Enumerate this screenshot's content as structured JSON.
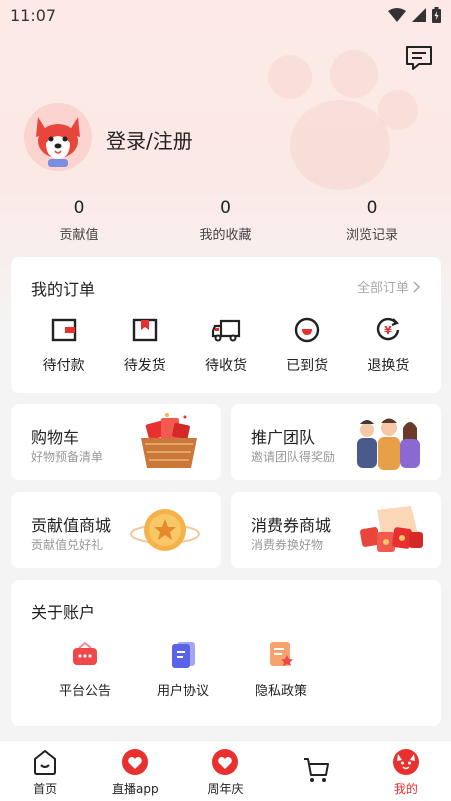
{
  "status_bar": {
    "time": "11:07"
  },
  "profile": {
    "login_text": "登录/注册"
  },
  "stats": [
    {
      "value": "0",
      "label": "贡献值"
    },
    {
      "value": "0",
      "label": "我的收藏"
    },
    {
      "value": "0",
      "label": "浏览记录"
    }
  ],
  "orders": {
    "title": "我的订单",
    "all_label": "全部订单",
    "items": [
      {
        "label": "待付款",
        "icon": "wallet-icon"
      },
      {
        "label": "待发货",
        "icon": "package-icon"
      },
      {
        "label": "待收货",
        "icon": "truck-icon"
      },
      {
        "label": "已到货",
        "icon": "smile-bag-icon"
      },
      {
        "label": "退换货",
        "icon": "refund-icon"
      }
    ]
  },
  "promos": [
    {
      "title": "购物车",
      "subtitle": "好物预备清单",
      "icon": "shopping-basket-icon"
    },
    {
      "title": "推广团队",
      "subtitle": "邀请团队得奖励",
      "icon": "team-people-icon"
    },
    {
      "title": "贡献值商城",
      "subtitle": "贡献值兑好礼",
      "icon": "star-coin-icon"
    },
    {
      "title": "消费券商城",
      "subtitle": "消费券换好物",
      "icon": "red-envelope-icon"
    }
  ],
  "account": {
    "title": "关于账户",
    "items": [
      {
        "label": "平台公告",
        "icon": "announcement-icon"
      },
      {
        "label": "用户协议",
        "icon": "agreement-icon"
      },
      {
        "label": "隐私政策",
        "icon": "privacy-policy-icon"
      }
    ]
  },
  "tabs": [
    {
      "label": "首页",
      "icon": "home-icon"
    },
    {
      "label": "直播app",
      "icon": "live-heart-icon"
    },
    {
      "label": "周年庆",
      "icon": "anniversary-heart-icon"
    },
    {
      "label": "",
      "icon": "cart-icon"
    },
    {
      "label": "我的",
      "icon": "profile-icon",
      "active": true
    }
  ],
  "colors": {
    "accent": "#e8312f",
    "text": "#222222",
    "muted": "#999999"
  }
}
